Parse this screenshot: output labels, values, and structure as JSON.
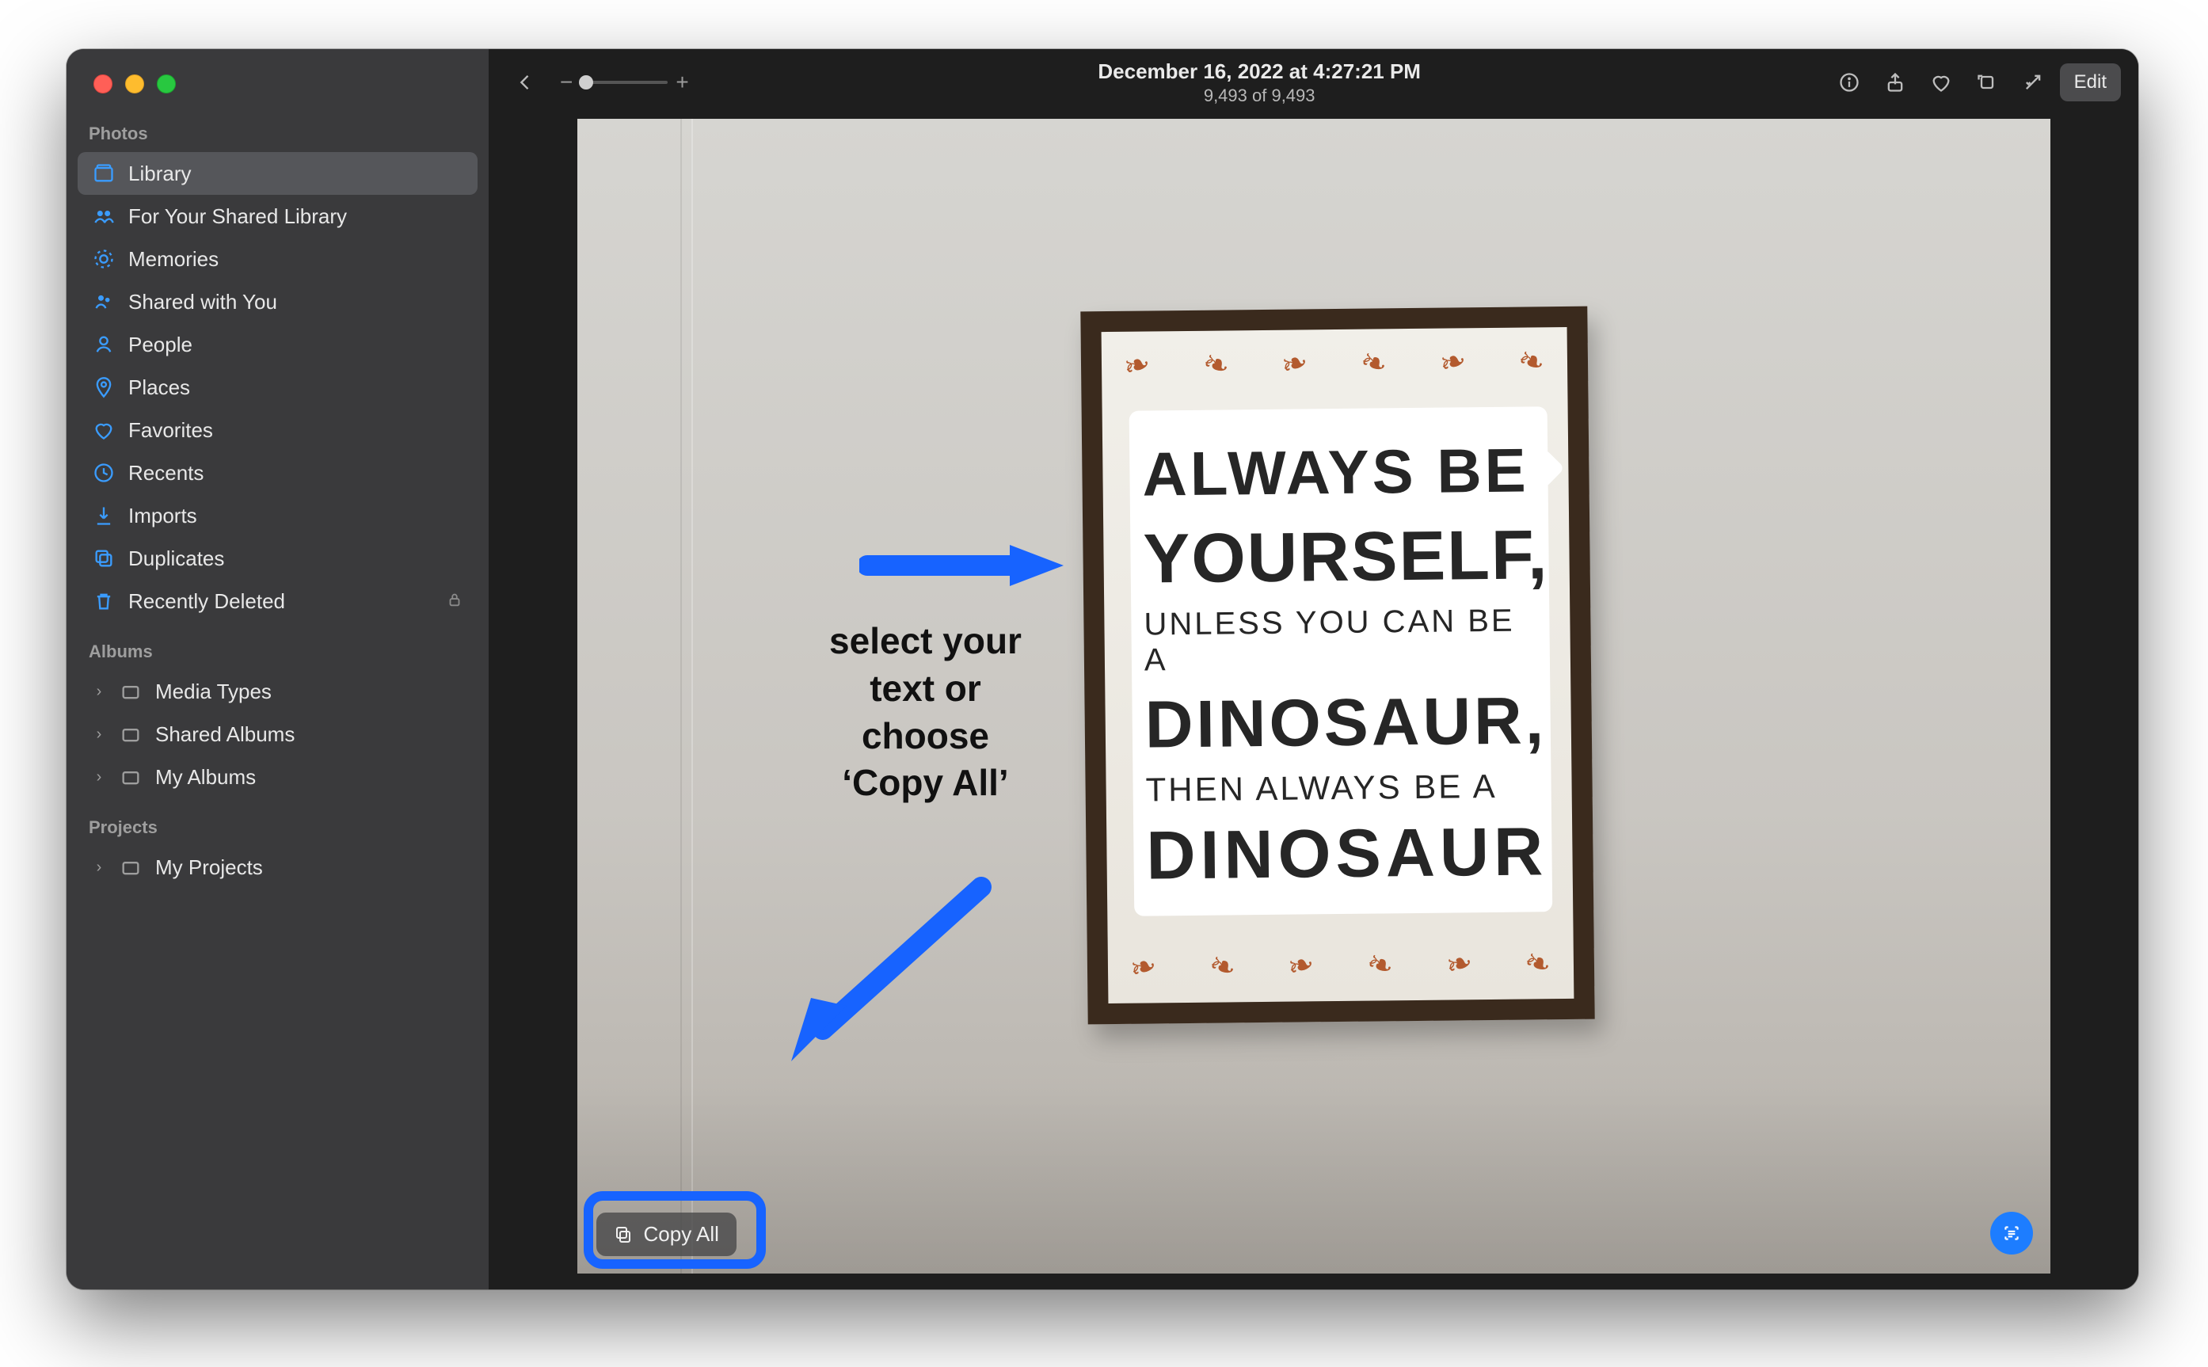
{
  "sidebar": {
    "sections": {
      "photos_header": "Photos",
      "albums_header": "Albums",
      "projects_header": "Projects"
    },
    "items": {
      "library": "Library",
      "for_shared": "For Your Shared Library",
      "memories": "Memories",
      "shared_with_you": "Shared with You",
      "people": "People",
      "places": "Places",
      "favorites": "Favorites",
      "recents": "Recents",
      "imports": "Imports",
      "duplicates": "Duplicates",
      "recently_deleted": "Recently Deleted",
      "media_types": "Media Types",
      "shared_albums": "Shared Albums",
      "my_albums": "My Albums",
      "my_projects": "My Projects"
    }
  },
  "header": {
    "date": "December 16, 2022 at 4:27:21 PM",
    "count": "9,493 of 9,493",
    "edit": "Edit"
  },
  "sign": {
    "l1": "ALWAYS BE",
    "l2": "YOURSELF,",
    "l3": "UNLESS YOU CAN BE A",
    "l4": "DINOSAUR,",
    "l5": "THEN ALWAYS BE A",
    "l6": "DINOSAUR"
  },
  "annotation": {
    "line1": "select your",
    "line2": "text or",
    "line3": "choose",
    "line4": "‘Copy All’"
  },
  "copy_all": "Copy All"
}
